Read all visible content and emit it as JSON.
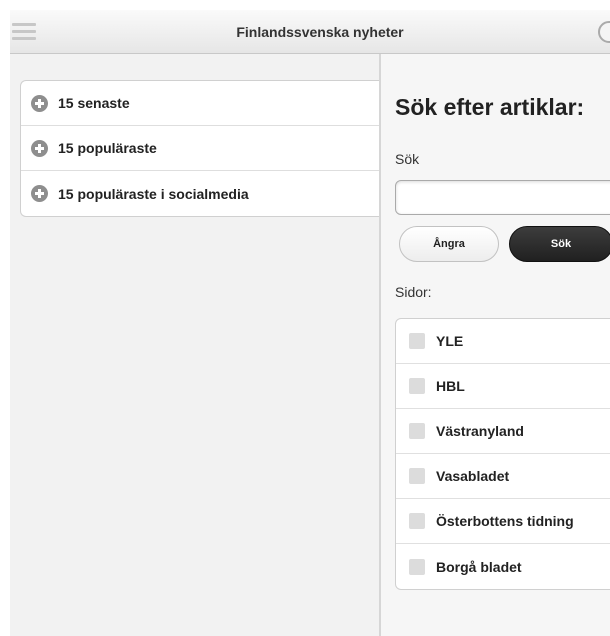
{
  "header": {
    "title": "Finlandssvenska nyheter",
    "menu_icon": "hamburger-menu-icon",
    "right_icon": "circle-icon"
  },
  "left_list": {
    "items": [
      {
        "label": "15 senaste",
        "icon": "plus-circle-icon"
      },
      {
        "label": "15 populäraste",
        "icon": "plus-circle-icon"
      },
      {
        "label": "15 populäraste i socialmedia",
        "icon": "plus-circle-icon"
      }
    ]
  },
  "search": {
    "heading": "Sök efter artiklar:",
    "field_label": "Sök",
    "input_value": "",
    "cancel_label": "Ångra",
    "submit_label": "Sök"
  },
  "sites": {
    "label": "Sidor:",
    "items": [
      {
        "label": "YLE",
        "checked": false
      },
      {
        "label": "HBL",
        "checked": false
      },
      {
        "label": "Västranyland",
        "checked": false
      },
      {
        "label": "Vasabladet",
        "checked": false
      },
      {
        "label": "Österbottens tidning",
        "checked": false
      },
      {
        "label": "Borgå bladet",
        "checked": false
      }
    ]
  },
  "colors": {
    "header_background": "#e9e9e9",
    "panel_background": "#f2f2f2",
    "primary_button": "#2b2b2b",
    "icon_gray": "#8e8e8e"
  }
}
